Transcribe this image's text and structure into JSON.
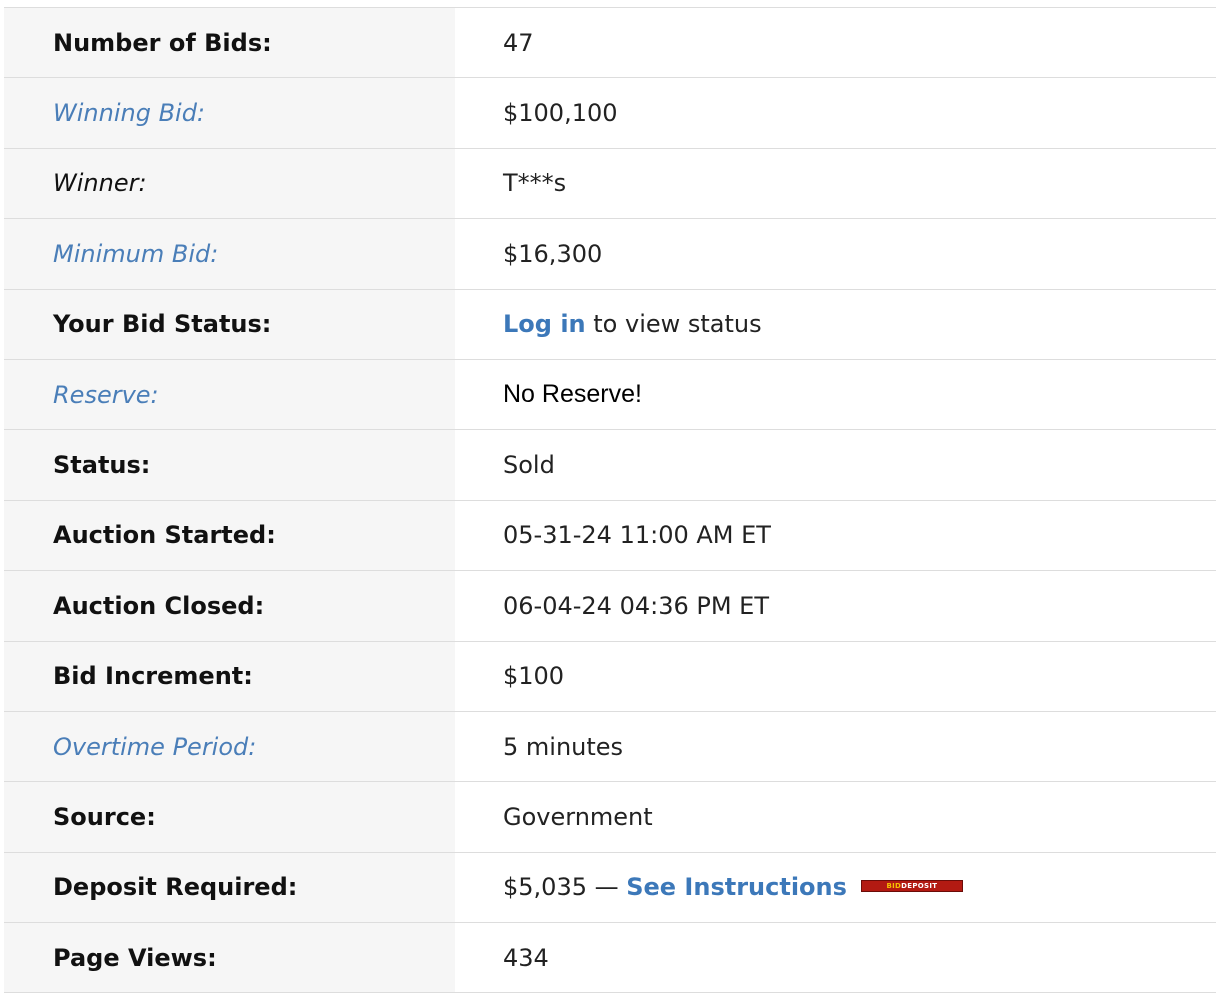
{
  "auction_details": {
    "rows": [
      {
        "label": "Number of Bids:",
        "value": "47"
      },
      {
        "label": "Winning Bid:",
        "value": "$100,100"
      },
      {
        "label": "Winner:",
        "value": "T***s"
      },
      {
        "label": "Minimum Bid:",
        "value": "$16,300"
      },
      {
        "label": "Your Bid Status:",
        "link": "Log in",
        "value": " to view status"
      },
      {
        "label": "Reserve:",
        "value": "No Reserve!"
      },
      {
        "label": "Status:",
        "value": "Sold"
      },
      {
        "label": "Auction Started:",
        "value": "05-31-24 11:00 AM ET"
      },
      {
        "label": "Auction Closed:",
        "value": "06-04-24 04:36 PM ET"
      },
      {
        "label": "Bid Increment:",
        "value": "$100"
      },
      {
        "label": "Overtime Period:",
        "value": "5 minutes"
      },
      {
        "label": "Source:",
        "value": "Government"
      },
      {
        "label": "Deposit Required:",
        "value": "$5,035 — ",
        "link": "See Instructions",
        "badge": {
          "part1": "BID",
          "part2": "DEPOSIT"
        }
      },
      {
        "label": "Page Views:",
        "value": "434"
      }
    ]
  },
  "colors": {
    "link": "#3c78b9",
    "label_link": "#4a7eb8",
    "label_background": "#f6f6f6",
    "divider": "#dddddd",
    "badge_red": "#b31a12",
    "badge_yellow": "#f5c400"
  }
}
